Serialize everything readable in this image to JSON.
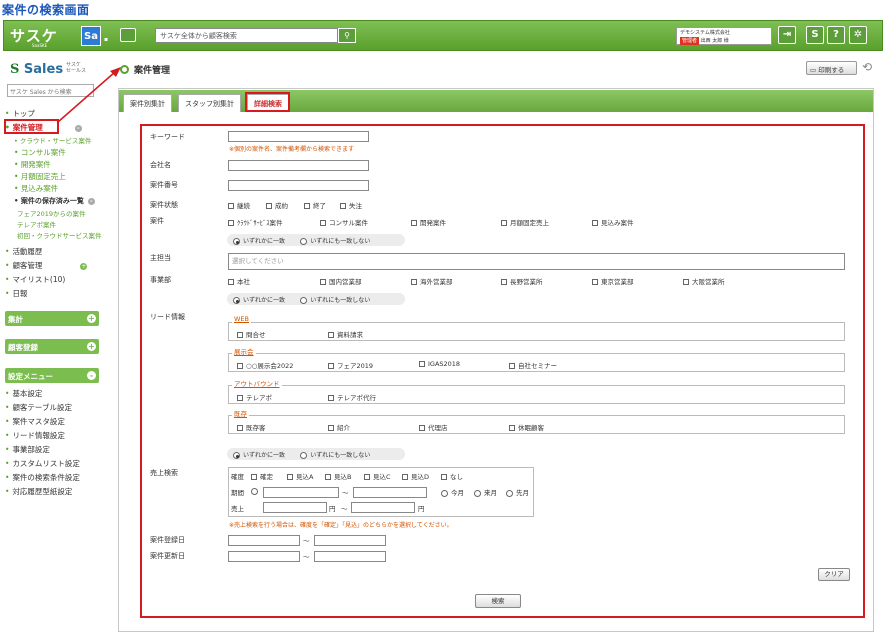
{
  "page_title": "案件の検索画面",
  "topbar": {
    "logo": "サスケ",
    "logo_sub": "SaaSKE",
    "sa_badge": "Sa",
    "search_placeholder": "サスケ全体から顧客検索",
    "company": "デモシステム株式会社",
    "admin_label": "管理者",
    "user": "出西 太郎 様"
  },
  "sidebar": {
    "logo": "Sales",
    "logo_sub1": "サスケ",
    "logo_sub2": "セールス",
    "search_placeholder": "サスケ Sales から検索",
    "items": [
      "トップ",
      "案件管理",
      "クラウド・サービス案件",
      "コンサル案件",
      "開発案件",
      "月額固定売上",
      "見込み案件",
      "案件の保存済み一覧",
      "フェア2019からの案件",
      "テレアポ案件",
      "初回・クラウドサービス案件",
      "活動履歴",
      "顧客管理",
      "マイリスト(10)",
      "日報"
    ],
    "bars": [
      "集計",
      "顧客登録",
      "設定メニュー"
    ],
    "settings": [
      "基本設定",
      "顧客テーブル設定",
      "案件マスタ設定",
      "リード情報設定",
      "事業部設定",
      "カスタムリスト設定",
      "案件の検索条件設定",
      "対応履歴型紙設定"
    ]
  },
  "main": {
    "header": "案件管理",
    "print": "印刷する",
    "tabs": [
      "案件別集計",
      "スタッフ別集計",
      "詳細検索"
    ]
  },
  "form": {
    "keyword_label": "キーワード",
    "keyword_note": "※個別の案件名、案件備考欄から検索できます",
    "name_label": "会社名",
    "number_label": "案件番号",
    "status_label": "案件状態",
    "statuses": [
      "継続",
      "成約",
      "終了",
      "失注"
    ],
    "case_label": "案件",
    "cases": [
      "ｸﾗｳﾄﾞｻｰﾋﾞｽ案件",
      "コンサル案件",
      "開発案件",
      "月額固定売上",
      "見込み案件"
    ],
    "any_match": "いずれかに一致",
    "none_match": "いずれにも一致しない",
    "staff_label": "主担当",
    "staff_placeholder": "選択してください",
    "dept_label": "事業部",
    "depts": [
      "本社",
      "国内営業部",
      "海外営業部",
      "長野営業所",
      "東京営業部",
      "大阪営業所"
    ],
    "lead_label": "リード情報",
    "lead_groups": [
      {
        "name": "WEB",
        "items": [
          "問合せ",
          "資料請求"
        ]
      },
      {
        "name": "展示会",
        "items": [
          "○○展示会2022",
          "フェア2019",
          "IGAS2018",
          "自社セミナー"
        ]
      },
      {
        "name": "アウトバウンド",
        "items": [
          "テレアポ",
          "テレアポ代行"
        ]
      },
      {
        "name": "既存",
        "items": [
          "既存客",
          "紹介",
          "代理店",
          "休眠顧客"
        ]
      }
    ],
    "sales_label": "売上検索",
    "certainty_label": "確度",
    "certainties": [
      "確定",
      "見込A",
      "見込B",
      "見込C",
      "見込D",
      "なし"
    ],
    "period_label": "期間",
    "tilde": "～",
    "periods": [
      "今月",
      "来月",
      "先月"
    ],
    "amount_label": "売上",
    "yen": "円",
    "sales_note": "※売上検索を行う場合は、確度を「確定」「見込」のどちらかを選択してください。",
    "reg_label": "案件登録日",
    "upd_label": "案件更新日",
    "clear": "クリア",
    "search": "検索"
  }
}
